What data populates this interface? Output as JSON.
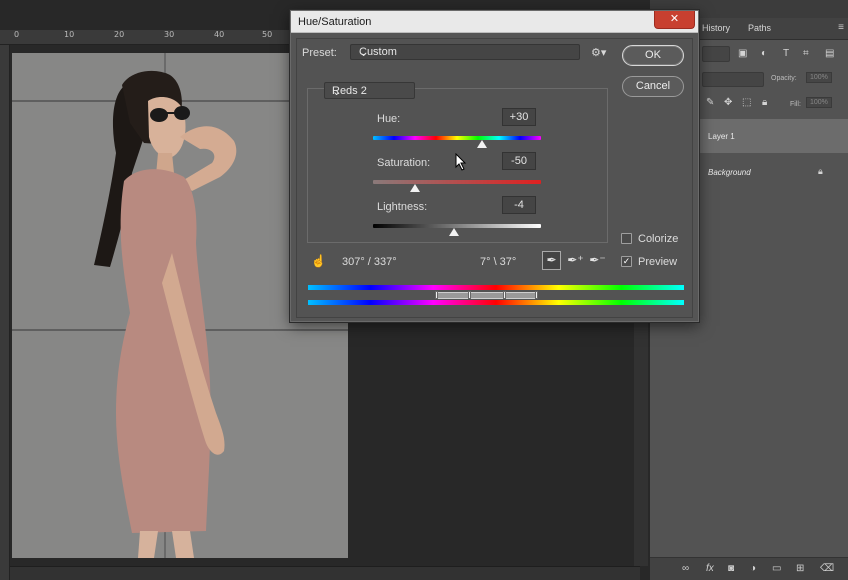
{
  "workspace": {
    "ruler_ticks": [
      "0",
      "10",
      "20",
      "30",
      "40",
      "50"
    ]
  },
  "panel": {
    "tabs": [
      "History",
      "Paths"
    ],
    "opacity_label": "Opacity:",
    "opacity_value": "100%",
    "fill_label": "Fill:",
    "fill_value": "100%",
    "layers": [
      {
        "name": "Layer 1",
        "selected": true
      },
      {
        "name": "Background",
        "selected": false,
        "locked": true
      }
    ]
  },
  "dialog": {
    "title": "Hue/Saturation",
    "close_symbol": "✕",
    "preset_label": "Preset:",
    "preset_value": "Custom",
    "ok_label": "OK",
    "cancel_label": "Cancel",
    "channel": "Reds 2",
    "hue_label": "Hue:",
    "hue_value": "+30",
    "hue_thumb_fraction": 0.65,
    "saturation_label": "Saturation:",
    "saturation_value": "-50",
    "saturation_thumb_fraction": 0.25,
    "lightness_label": "Lightness:",
    "lightness_value": "-4",
    "lightness_thumb_fraction": 0.48,
    "range_left": "307° / 337°",
    "range_right": "7° \\ 37°",
    "colorize_label": "Colorize",
    "colorize_checked": false,
    "preview_label": "Preview",
    "preview_checked": true
  },
  "colors": {
    "dialog_bg": "#535353",
    "title_bar": "#e9e9e9",
    "close_red": "#c84030",
    "panel_bg": "#535353",
    "workspace_bg": "#282828"
  }
}
